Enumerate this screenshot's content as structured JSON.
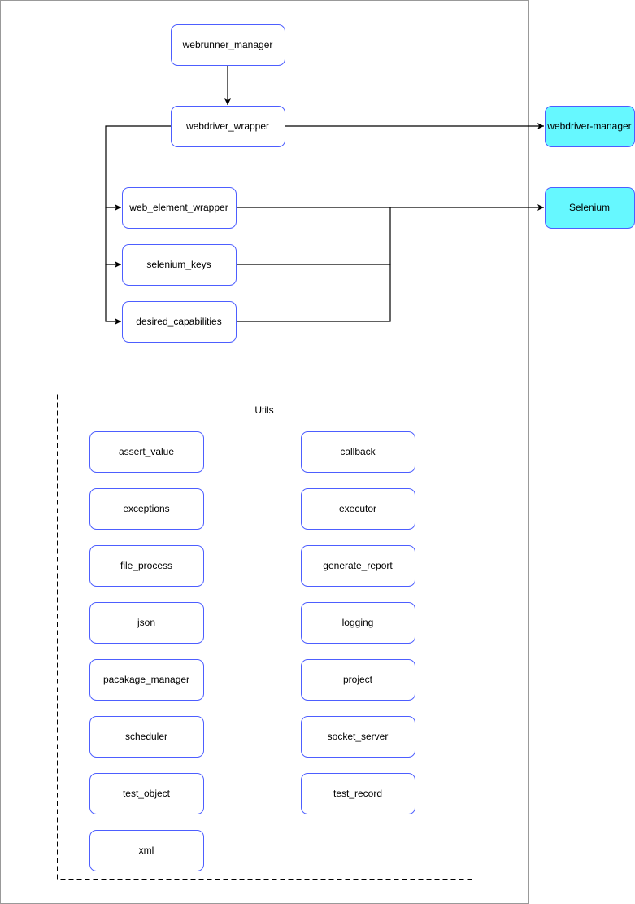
{
  "colors": {
    "node_border": "#4d5eff",
    "external_fill": "#66f8ff",
    "frame_border": "#999999",
    "edge": "#000000"
  },
  "nodes": {
    "webrunner_manager": "webrunner_manager",
    "webdriver_wrapper": "webdriver_wrapper",
    "web_element_wrapper": "web_element_wrapper",
    "selenium_keys": "selenium_keys",
    "desired_capabilities": "desired_capabilities"
  },
  "external": {
    "webdriver_manager": "webdriver-manager",
    "selenium": "Selenium"
  },
  "utils": {
    "title": "Utils",
    "left": [
      "assert_value",
      "exceptions",
      "file_process",
      "json",
      "pacakage_manager",
      "scheduler",
      "test_object",
      "xml"
    ],
    "right": [
      "callback",
      "executor",
      "generate_report",
      "logging",
      "project",
      "socket_server",
      "test_record"
    ]
  }
}
